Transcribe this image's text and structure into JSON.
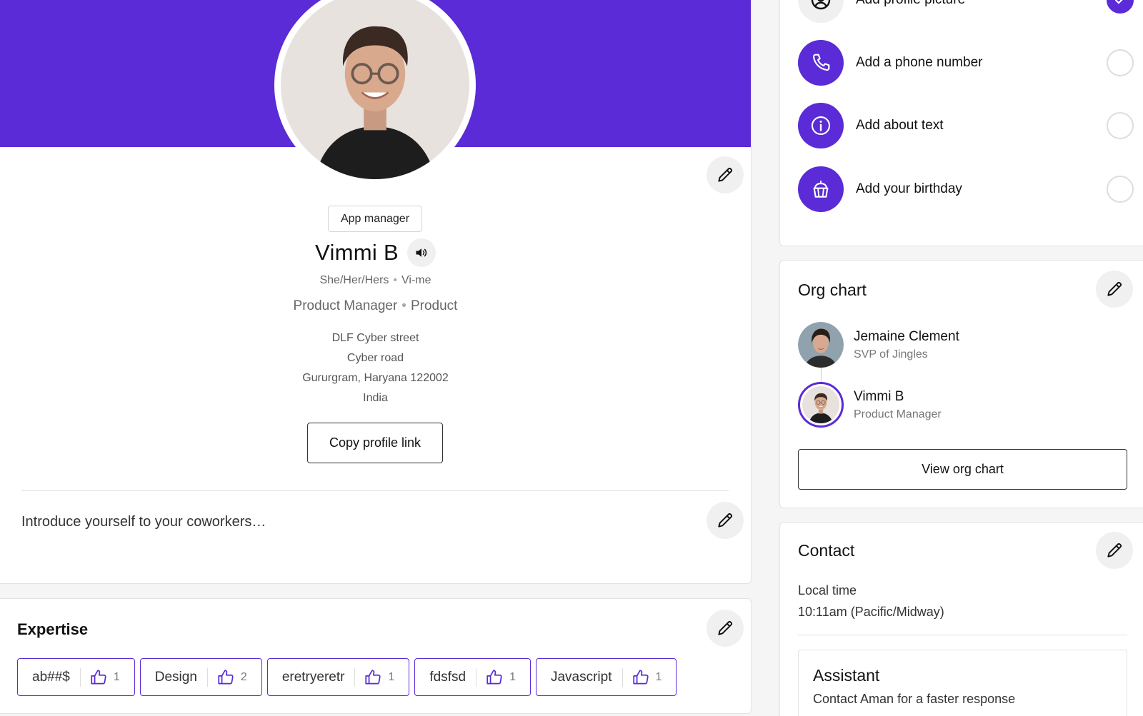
{
  "colors": {
    "brand": "#5a2bd6",
    "banner": "#5a2bd6"
  },
  "profile": {
    "role_chip": "App manager",
    "name": "Vimmi B",
    "pronouns": "She/Her/Hers",
    "pronunciation": "Vi-me",
    "job_title": "Product Manager",
    "department": "Product",
    "address": {
      "line1": "DLF Cyber street",
      "line2": "Cyber road",
      "city": "Gururgram,",
      "state": "Haryana",
      "zip": "122002",
      "country": "India"
    },
    "copy_link_label": "Copy profile link",
    "intro_placeholder": "Introduce yourself to your coworkers…"
  },
  "expertise": {
    "title": "Expertise",
    "skills": [
      {
        "name": "ab##$",
        "likes": "1"
      },
      {
        "name": "Design",
        "likes": "2"
      },
      {
        "name": "eretryeretr",
        "likes": "1"
      },
      {
        "name": "fdsfsd",
        "likes": "1"
      },
      {
        "name": "Javascript",
        "likes": "1"
      }
    ]
  },
  "checklist": {
    "items": [
      {
        "label": "Add profile picture",
        "icon": "profile-picture-icon",
        "done": true
      },
      {
        "label": "Add a phone number",
        "icon": "phone-icon",
        "done": false
      },
      {
        "label": "Add about text",
        "icon": "info-icon",
        "done": false
      },
      {
        "label": "Add your birthday",
        "icon": "cake-icon",
        "done": false
      }
    ]
  },
  "org_chart": {
    "title": "Org chart",
    "manager": {
      "name": "Jemaine Clement",
      "role": "SVP of Jingles"
    },
    "self": {
      "name": "Vimmi B",
      "role": "Product Manager"
    },
    "view_label": "View org chart"
  },
  "contact": {
    "title": "Contact",
    "local_time_label": "Local time",
    "local_time_value": "10:11am (Pacific/Midway)",
    "assistant_title": "Assistant",
    "assistant_text": "Contact Aman for a faster response"
  }
}
